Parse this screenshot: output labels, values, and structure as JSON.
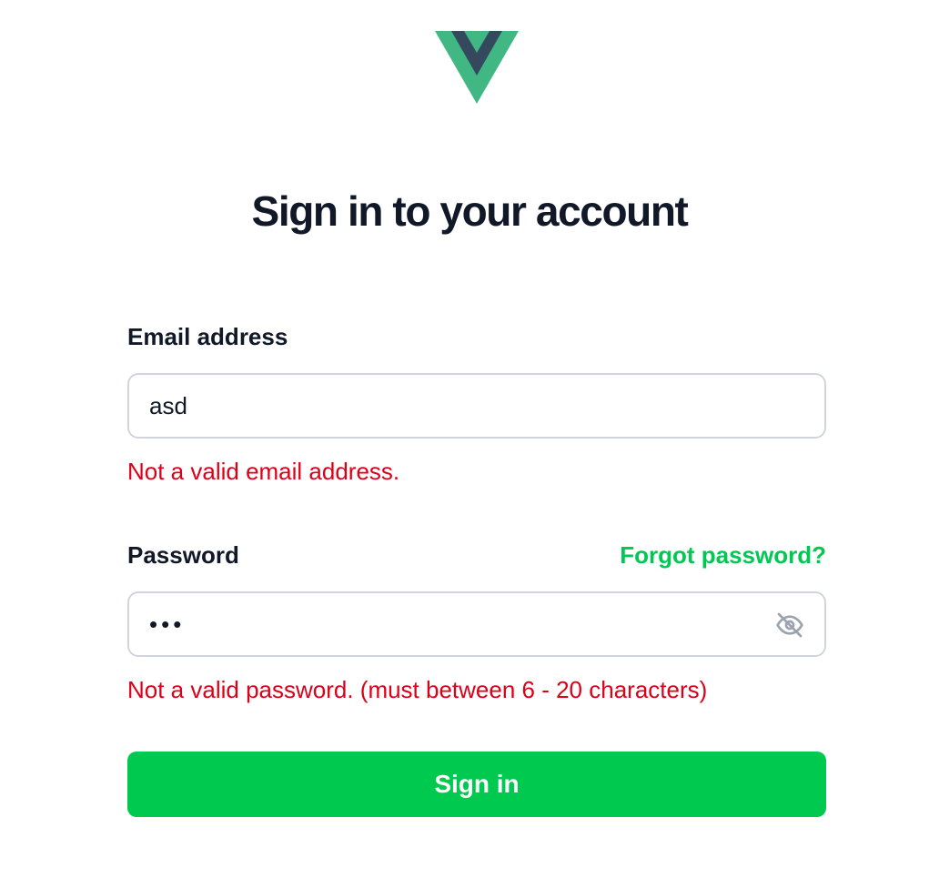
{
  "logo": {
    "icon": "vue-logo-icon",
    "colors": {
      "outer": "#41b883",
      "inner": "#35495e"
    }
  },
  "heading": "Sign in to your account",
  "email": {
    "label": "Email address",
    "value": "asd",
    "error": "Not a valid email address."
  },
  "password": {
    "label": "Password",
    "value": "•••",
    "forgot_link": "Forgot password?",
    "toggle_icon": "eye-slash-icon",
    "error": "Not a valid password. (must between 6 - 20 characters)"
  },
  "submit_label": "Sign in",
  "colors": {
    "accent": "#00c950",
    "link": "#00c853",
    "error": "#dc0019",
    "text": "#111827",
    "border": "#d1d5db"
  }
}
